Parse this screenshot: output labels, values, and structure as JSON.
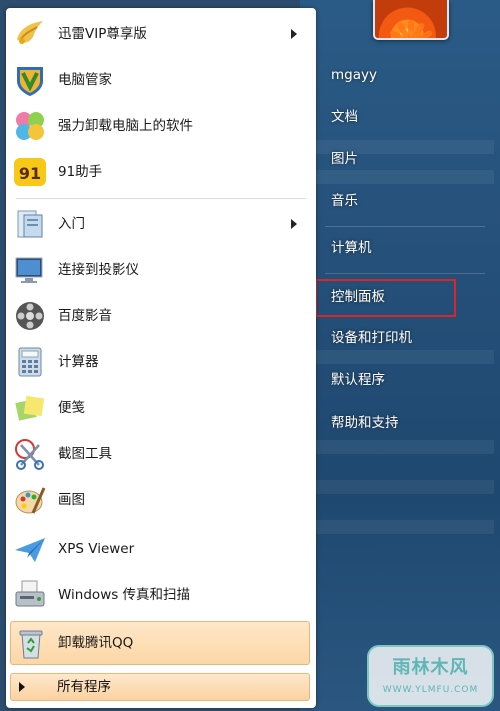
{
  "programs": [
    {
      "label": "迅雷VIP尊享版",
      "icon": "thunder-bird-icon",
      "has_submenu": true
    },
    {
      "label": "电脑管家",
      "icon": "shield-v-icon",
      "has_submenu": false
    },
    {
      "label": "强力卸载电脑上的软件",
      "icon": "pinwheel-icon",
      "has_submenu": false
    },
    {
      "label": "91助手",
      "icon": "91-assistant-icon",
      "has_submenu": false
    },
    {
      "label": "入门",
      "icon": "getting-started-icon",
      "has_submenu": true
    },
    {
      "label": "连接到投影仪",
      "icon": "projector-monitor-icon",
      "has_submenu": false
    },
    {
      "label": "百度影音",
      "icon": "film-reel-icon",
      "has_submenu": false
    },
    {
      "label": "计算器",
      "icon": "calculator-icon",
      "has_submenu": false
    },
    {
      "label": "便笺",
      "icon": "sticky-notes-icon",
      "has_submenu": false
    },
    {
      "label": "截图工具",
      "icon": "scissors-icon",
      "has_submenu": false
    },
    {
      "label": "画图",
      "icon": "paint-palette-icon",
      "has_submenu": false
    },
    {
      "label": "XPS Viewer",
      "icon": "paper-plane-icon",
      "has_submenu": false
    },
    {
      "label": "Windows 传真和扫描",
      "icon": "fax-scanner-icon",
      "has_submenu": false
    }
  ],
  "uninstall_qq": {
    "label": "卸载腾讯QQ",
    "icon": "recycle-bin-icon"
  },
  "all_programs": {
    "label": "所有程序"
  },
  "right_items": [
    {
      "label": "mgayy"
    },
    {
      "label": "文档"
    },
    {
      "label": "图片"
    },
    {
      "label": "音乐"
    },
    {
      "label": "计算机"
    },
    {
      "label": "控制面板"
    },
    {
      "label": "设备和打印机"
    },
    {
      "label": "默认程序"
    },
    {
      "label": "帮助和支持"
    }
  ],
  "watermark": {
    "main": "雨林木风",
    "sub": "WWW.YLMFU.COM"
  }
}
